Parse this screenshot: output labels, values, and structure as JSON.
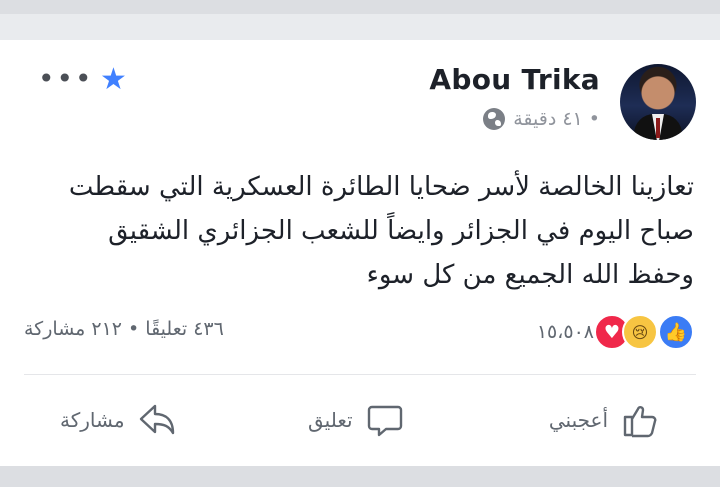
{
  "post": {
    "author": "Abou Trika",
    "time": "٤١ دقيقة •",
    "text_lines": [
      "تعازينا الخالصة لأسر ضحايا الطائرة العسكرية التي سقطت",
      "صباح اليوم في الجزائر وايضاً للشعب الجزائري الشقيق",
      "وحفظ الله الجميع من كل سوء"
    ],
    "reaction_count": "١٥،٥٠٨",
    "stats": "٤٣٦ تعليقًا • ٢١٢ مشاركة"
  },
  "actions": {
    "like": "أعجبني",
    "comment": "تعليق",
    "share": "مشاركة"
  },
  "icons": {
    "more": "more-horizontal-icon",
    "favorite": "star-icon",
    "privacy": "globe-icon"
  },
  "colors": {
    "accent": "#4080ff",
    "text": "#1d2129",
    "muted": "#90949c"
  }
}
